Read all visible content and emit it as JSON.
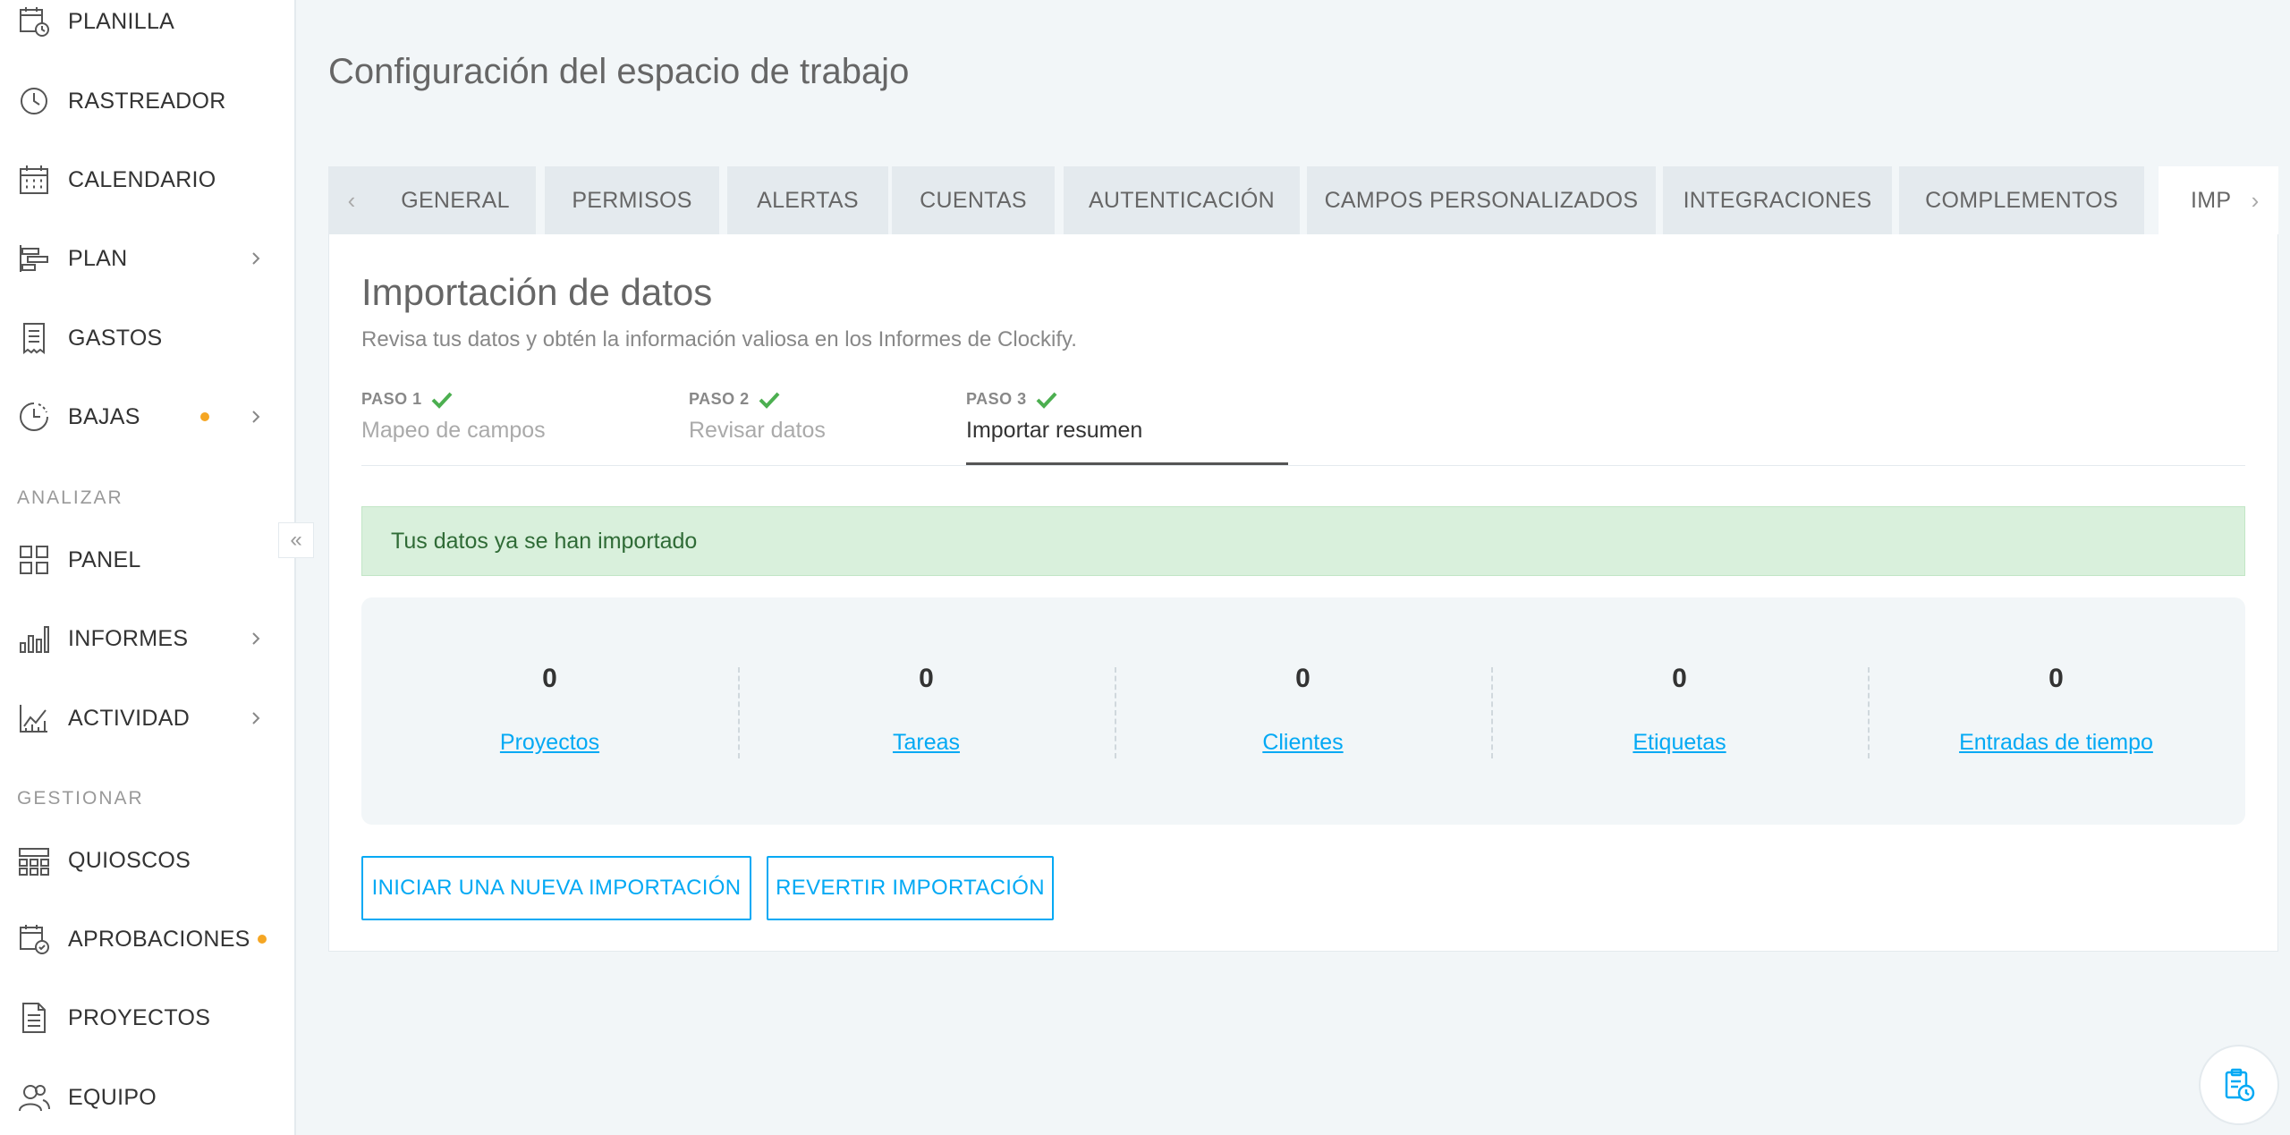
{
  "sidebar": {
    "items_top": [
      {
        "label": "PLANILLA",
        "icon": "timesheet-icon"
      },
      {
        "label": "RASTREADOR",
        "icon": "clock-icon"
      },
      {
        "label": "CALENDARIO",
        "icon": "calendar-icon"
      },
      {
        "label": "PLAN",
        "icon": "schedule-icon"
      },
      {
        "label": "GASTOS",
        "icon": "receipt-icon"
      },
      {
        "label": "BAJAS",
        "icon": "time-off-icon"
      }
    ],
    "section_analyze": "ANALIZAR",
    "items_analyze": [
      {
        "label": "PANEL",
        "icon": "dashboard-icon"
      },
      {
        "label": "INFORMES",
        "icon": "reports-icon"
      },
      {
        "label": "ACTIVIDAD",
        "icon": "activity-icon"
      }
    ],
    "section_manage": "GESTIONAR",
    "items_manage": [
      {
        "label": "QUIOSCOS",
        "icon": "kiosk-icon"
      },
      {
        "label": "APROBACIONES",
        "icon": "approvals-icon"
      },
      {
        "label": "PROYECTOS",
        "icon": "projects-icon"
      },
      {
        "label": "EQUIPO",
        "icon": "team-icon"
      }
    ],
    "collapse_glyph": "«",
    "badge_color": "#f5a623"
  },
  "page": {
    "title": "Configuración del espacio de trabajo"
  },
  "tabs": [
    "GENERAL",
    "PERMISOS",
    "ALERTAS",
    "CUENTAS",
    "AUTENTICACIÓN",
    "CAMPOS PERSONALIZADOS",
    "INTEGRACIONES",
    "COMPLEMENTOS",
    "IMP"
  ],
  "tab_arrows": {
    "left": "‹",
    "right": "›"
  },
  "import": {
    "title": "Importación de datos",
    "subtitle": "Revisa tus datos y obtén la información valiosa en los Informes de Clockify.",
    "steps": [
      {
        "num": "PASO 1",
        "name": "Mapeo de campos"
      },
      {
        "num": "PASO 2",
        "name": "Revisar datos"
      },
      {
        "num": "PASO 3",
        "name": "Importar resumen"
      }
    ],
    "alert": "Tus datos ya se han importado",
    "stats": [
      {
        "value": "0",
        "label": "Proyectos"
      },
      {
        "value": "0",
        "label": "Tareas"
      },
      {
        "value": "0",
        "label": "Clientes"
      },
      {
        "value": "0",
        "label": "Etiquetas"
      },
      {
        "value": "0",
        "label": "Entradas de tiempo"
      }
    ],
    "btn_new": "INICIAR UNA NUEVA IMPORTACIÓN",
    "btn_revert": "REVERTIR IMPORTACIÓN"
  },
  "colors": {
    "accent": "#03a9f4",
    "success_bg": "#d9f0dc",
    "success_text": "#2f6b36",
    "check": "#4caf50"
  }
}
